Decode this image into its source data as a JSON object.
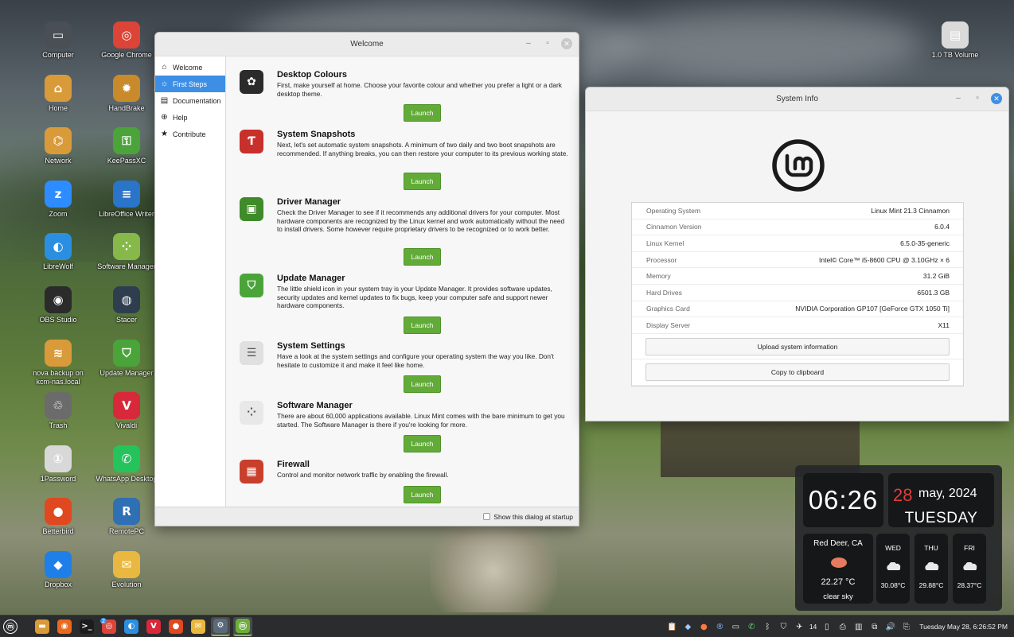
{
  "desktop": {
    "icons_col1": [
      {
        "label": "Computer",
        "icon": "monitor-icon",
        "color": "#4a4f55"
      },
      {
        "label": "Home",
        "icon": "home-folder-icon",
        "color": "#d99a3a"
      },
      {
        "label": "Network",
        "icon": "network-folder-icon",
        "color": "#d99a3a"
      },
      {
        "label": "Zoom",
        "icon": "zoom-icon",
        "color": "#2d8cff"
      },
      {
        "label": "LibreWolf",
        "icon": "librewolf-icon",
        "color": "#2a8fe0"
      },
      {
        "label": "OBS Studio",
        "icon": "obs-icon",
        "color": "#2b2b2b"
      },
      {
        "label": "nova backup on kcm-nas.local",
        "icon": "network-share-icon",
        "color": "#d99a3a"
      },
      {
        "label": "Trash",
        "icon": "trash-icon",
        "color": "#6b6b6b"
      },
      {
        "label": "1Password",
        "icon": "1password-icon",
        "color": "#d8d8d8"
      },
      {
        "label": "Betterbird",
        "icon": "betterbird-icon",
        "color": "#e0481f"
      },
      {
        "label": "Dropbox",
        "icon": "dropbox-icon",
        "color": "#1e7fe8"
      }
    ],
    "icons_col2": [
      {
        "label": "Google Chrome",
        "icon": "chrome-icon",
        "color": "#db4437"
      },
      {
        "label": "HandBrake",
        "icon": "handbrake-icon",
        "color": "#c98a2b"
      },
      {
        "label": "KeePassXC",
        "icon": "keepassxc-icon",
        "color": "#4aa43a"
      },
      {
        "label": "LibreOffice Writer",
        "icon": "writer-icon",
        "color": "#2a74c9"
      },
      {
        "label": "Software Manager",
        "icon": "software-manager-icon",
        "color": "#86b84a"
      },
      {
        "label": "Stacer",
        "icon": "stacer-icon",
        "color": "#2f3e4e"
      },
      {
        "label": "Update Manager",
        "icon": "update-shield-icon",
        "color": "#4aa43a"
      },
      {
        "label": "Vivaldi",
        "icon": "vivaldi-icon",
        "color": "#d7293a"
      },
      {
        "label": "WhatsApp Desktop",
        "icon": "whatsapp-icon",
        "color": "#25c35b"
      },
      {
        "label": "RemotePC",
        "icon": "remotepc-icon",
        "color": "#2f6fb4"
      },
      {
        "label": "Evolution",
        "icon": "evolution-mail-icon",
        "color": "#e8b840"
      }
    ],
    "icons_right": [
      {
        "label": "1.0 TB Volume",
        "icon": "drive-icon",
        "color": "#dadada"
      }
    ]
  },
  "welcome": {
    "title": "Welcome",
    "sidebar": [
      {
        "label": "Welcome",
        "icon": "home-icon"
      },
      {
        "label": "First Steps",
        "icon": "lightbulb-icon"
      },
      {
        "label": "Documentation",
        "icon": "book-icon"
      },
      {
        "label": "Help",
        "icon": "lifebuoy-icon"
      },
      {
        "label": "Contribute",
        "icon": "star-icon"
      }
    ],
    "steps": [
      {
        "title": "Desktop Colours",
        "desc": "First, make yourself at home. Choose your favorite colour and whether you prefer a light or a dark desktop theme.",
        "button": "Launch",
        "icon": "colour-wheel-icon",
        "color": "#2b2b2b"
      },
      {
        "title": "System Snapshots",
        "desc": "Next, let's set automatic system snapshots. A minimum of two daily and two boot snapshots are recommended. If anything breaks, you can then restore your computer to its previous working state.",
        "button": "Launch",
        "icon": "timeshift-icon",
        "color": "#c8302c"
      },
      {
        "title": "Driver Manager",
        "desc": "Check the Driver Manager to see if it recommends any additional drivers for your computer. Most hardware components are recognized by the Linux kernel and work automatically without the need to install drivers. Some however require proprietary drivers to be recognized or to work better.",
        "button": "Launch",
        "icon": "chip-icon",
        "color": "#3f8a2a"
      },
      {
        "title": "Update Manager",
        "desc": "The little shield icon in your system tray is your Update Manager. It provides software updates, security updates and kernel updates to fix bugs, keep your computer safe and support newer hardware components.",
        "button": "Launch",
        "icon": "shield-icon",
        "color": "#4aa43a"
      },
      {
        "title": "System Settings",
        "desc": "Have a look at the system settings and configure your operating system the way you like. Don't hesitate to customize it and make it feel like home.",
        "button": "Launch",
        "icon": "toggles-icon",
        "color": "#e0e0e0"
      },
      {
        "title": "Software Manager",
        "desc": "There are about 60,000 applications available. Linux Mint comes with the bare minimum to get you started. The Software Manager is there if you're looking for more.",
        "button": "Launch",
        "icon": "software-grid-icon",
        "color": "#e8e8e8"
      },
      {
        "title": "Firewall",
        "desc": "Control and monitor network traffic by enabling the firewall.",
        "button": "Launch",
        "icon": "brick-wall-icon",
        "color": "#c8402c"
      }
    ],
    "footer_checkbox": "Show this dialog at startup"
  },
  "sysinfo": {
    "title": "System Info",
    "rows": [
      {
        "k": "Operating System",
        "v": "Linux Mint 21.3 Cinnamon"
      },
      {
        "k": "Cinnamon Version",
        "v": "6.0.4"
      },
      {
        "k": "Linux Kernel",
        "v": "6.5.0-35-generic"
      },
      {
        "k": "Processor",
        "v": "Intel© Core™ i5-8600 CPU @ 3.10GHz × 6"
      },
      {
        "k": "Memory",
        "v": "31.2 GiB"
      },
      {
        "k": "Hard Drives",
        "v": "6501.3 GB"
      },
      {
        "k": "Graphics Card",
        "v": "NVIDIA Corporation GP107 [GeForce GTX 1050 Ti]"
      },
      {
        "k": "Display Server",
        "v": "X11"
      }
    ],
    "upload_button": "Upload system information",
    "copy_button": "Copy to clipboard"
  },
  "widget": {
    "time": "06:26",
    "day": "28",
    "month_year": "may, 2024",
    "weekday": "TUESDAY",
    "city": "Red Deer, CA",
    "temp": "22.27 °C",
    "condition": "clear sky",
    "forecast": [
      {
        "day": "WED",
        "temp": "30.08°C"
      },
      {
        "day": "THU",
        "temp": "29.88°C"
      },
      {
        "day": "FRI",
        "temp": "28.37°C"
      }
    ]
  },
  "taskbar": {
    "apps": [
      {
        "name": "menu",
        "icon": "mint-menu-icon",
        "color": "#2b2c2e"
      },
      {
        "name": "files",
        "icon": "folder-icon",
        "color": "#d99a3a"
      },
      {
        "name": "firefox",
        "icon": "firefox-icon",
        "color": "#e86a1e"
      },
      {
        "name": "terminal",
        "icon": "terminal-icon",
        "color": "#1c1c1c"
      },
      {
        "name": "chrome",
        "icon": "chrome-icon",
        "color": "#db4437"
      },
      {
        "name": "librewolf",
        "icon": "librewolf-icon",
        "color": "#2a8fe0"
      },
      {
        "name": "vivaldi",
        "icon": "vivaldi-icon",
        "color": "#d7293a"
      },
      {
        "name": "betterbird",
        "icon": "betterbird-icon",
        "color": "#e0481f"
      },
      {
        "name": "evolution",
        "icon": "evolution-mail-icon",
        "color": "#e8b840"
      },
      {
        "name": "settings",
        "icon": "gear-icon",
        "color": "#5a6a7a"
      },
      {
        "name": "welcome",
        "icon": "mint-welcome-icon",
        "color": "#6cae3a"
      }
    ],
    "badge_count": "2",
    "volume": "14",
    "clock": "Tuesday May 28, 6:26:52 PM"
  }
}
